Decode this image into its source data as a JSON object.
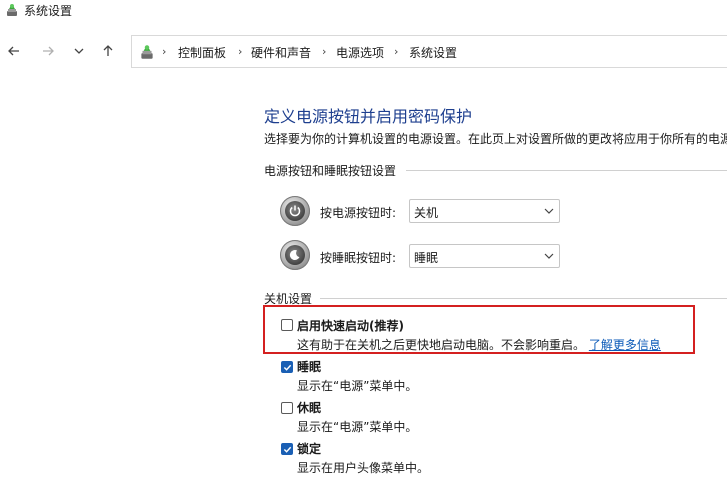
{
  "window": {
    "title": "系统设置"
  },
  "breadcrumb": [
    "控制面板",
    "硬件和声音",
    "电源选项",
    "系统设置"
  ],
  "page": {
    "heading": "定义电源按钮并启用密码保护",
    "description": "选择要为你的计算机设置的电源设置。在此页上对设置所做的更改将应用于你所有的电源"
  },
  "power_section": {
    "title": "电源按钮和睡眠按钮设置",
    "power_button": {
      "label": "按电源按钮时:",
      "value": "关机"
    },
    "sleep_button": {
      "label": "按睡眠按钮时:",
      "value": "睡眠"
    }
  },
  "shutdown_section": {
    "title": "关机设置",
    "options": [
      {
        "label": "启用快速启动(推荐)",
        "desc": "这有助于在关机之后更快地启动电脑。不会影响重启。",
        "link": "了解更多信息",
        "checked": false
      },
      {
        "label": "睡眠",
        "desc": "显示在“电源”菜单中。",
        "checked": true
      },
      {
        "label": "休眠",
        "desc": "显示在“电源”菜单中。",
        "checked": false
      },
      {
        "label": "锁定",
        "desc": "显示在用户头像菜单中。",
        "checked": true
      }
    ]
  },
  "colors": {
    "heading": "#1e3f8f",
    "link": "#0b5ab8",
    "checkbox": "#1a5fb4",
    "highlight": "#d42020"
  },
  "icons": [
    "back-arrow-icon",
    "forward-arrow-icon",
    "recent-locations-icon",
    "up-arrow-icon",
    "power-options-icon",
    "power-button-icon",
    "sleep-button-icon"
  ]
}
